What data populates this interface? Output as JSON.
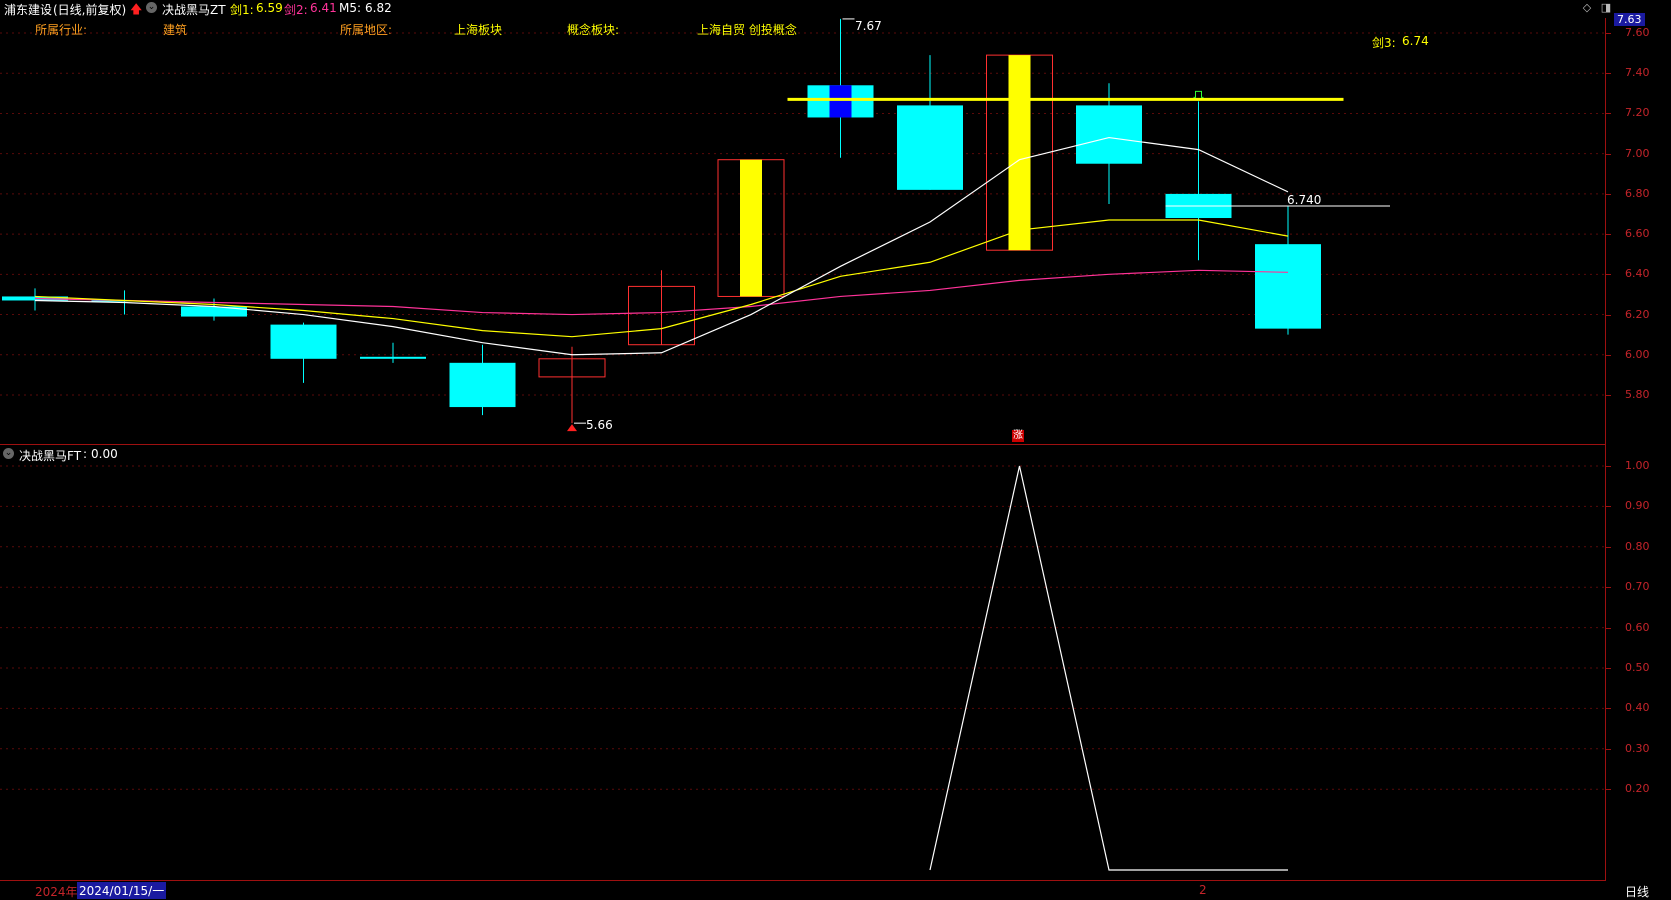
{
  "header": {
    "stock_name": "浦东建设",
    "period": "(日线,前复权)",
    "indicator_name": "决战黑马ZT",
    "values": [
      {
        "label": "剑1:",
        "value": "6.59",
        "color": "#ffff00"
      },
      {
        "label": "剑2:",
        "value": "6.41",
        "color": "#ff3399"
      },
      {
        "label": "M5:",
        "value": "6.82",
        "color": "#ffffff"
      }
    ]
  },
  "info_row": {
    "industry_label": "所属行业:",
    "industry_value": "建筑",
    "region_label": "所属地区:",
    "region_value": "上海板块",
    "concept_label": "概念板块:",
    "concept_value": "上海自贸 创投概念"
  },
  "annotations": {
    "high_marker": "7.67",
    "low_marker": "5.66",
    "jian3": "剑3:",
    "jian3_value": "6.74",
    "last_price_label": "6.740",
    "up_marker": "涨"
  },
  "top_right": {
    "current_price": "7.63"
  },
  "main_axis": {
    "ticks": [
      "7.60",
      "7.40",
      "7.20",
      "7.00",
      "6.80",
      "6.60",
      "6.40",
      "6.20",
      "6.00",
      "5.80"
    ]
  },
  "sub_panel": {
    "title": "决战黑马FT",
    "value": "0.00",
    "ticks": [
      "1.00",
      "0.90",
      "0.80",
      "0.70",
      "0.60",
      "0.50",
      "0.40",
      "0.30",
      "0.20"
    ]
  },
  "footer": {
    "year": "2024年",
    "date": "2024/01/15/一",
    "mid_marker": "2",
    "period_button": "日线"
  },
  "chart_data": {
    "type": "candlestick",
    "candles": [
      {
        "o": 6.29,
        "c": 6.27,
        "h": 6.33,
        "l": 6.22
      },
      {
        "o": 6.27,
        "c": 6.27,
        "h": 6.32,
        "l": 6.2
      },
      {
        "o": 6.24,
        "c": 6.19,
        "h": 6.28,
        "l": 6.17
      },
      {
        "o": 6.15,
        "c": 5.98,
        "h": 6.16,
        "l": 5.86
      },
      {
        "o": 5.99,
        "c": 5.98,
        "h": 6.06,
        "l": 5.96
      },
      {
        "o": 5.96,
        "c": 5.74,
        "h": 6.05,
        "l": 5.7
      },
      {
        "o": 5.89,
        "c": 5.98,
        "h": 6.04,
        "l": 5.66
      },
      {
        "o": 6.05,
        "c": 6.34,
        "h": 6.42,
        "l": 6.05
      },
      {
        "o": 6.29,
        "c": 6.97,
        "h": 6.97,
        "l": 6.29
      },
      {
        "o": 7.34,
        "c": 7.18,
        "h": 7.67,
        "l": 6.98
      },
      {
        "o": 7.24,
        "c": 6.82,
        "h": 7.49,
        "l": 6.82
      },
      {
        "o": 6.52,
        "c": 7.49,
        "h": 7.49,
        "l": 6.52
      },
      {
        "o": 7.24,
        "c": 6.95,
        "h": 7.35,
        "l": 6.75
      },
      {
        "o": 6.8,
        "c": 6.68,
        "h": 7.26,
        "l": 6.47
      },
      {
        "o": 6.55,
        "c": 6.13,
        "h": 6.74,
        "l": 6.1
      }
    ],
    "m5": [
      6.27,
      6.26,
      6.24,
      6.2,
      6.14,
      6.06,
      6.0,
      6.01,
      6.2,
      6.44,
      6.66,
      6.97,
      7.08,
      7.02,
      6.81
    ],
    "jian1": [
      6.29,
      6.27,
      6.25,
      6.22,
      6.18,
      6.12,
      6.09,
      6.13,
      6.25,
      6.39,
      6.46,
      6.62,
      6.67,
      6.67,
      6.59
    ],
    "jian2": [
      6.28,
      6.27,
      6.26,
      6.25,
      6.24,
      6.21,
      6.2,
      6.21,
      6.24,
      6.29,
      6.32,
      6.37,
      6.4,
      6.42,
      6.41
    ],
    "yellow_line_level": 7.27,
    "last_price_line_level": 6.74,
    "ylim": [
      5.62,
      7.7
    ],
    "ft": [
      null,
      null,
      null,
      null,
      null,
      null,
      null,
      null,
      null,
      null,
      0.0,
      1.0,
      0.0,
      0.0,
      0.0
    ],
    "ft_ylim": [
      0,
      1.0
    ]
  },
  "colors": {
    "up": "#ff3030",
    "down": "#00ffff",
    "yellow_bar": "#ffff00",
    "blue_bar": "#0000ff",
    "axis": "#c4242a"
  }
}
